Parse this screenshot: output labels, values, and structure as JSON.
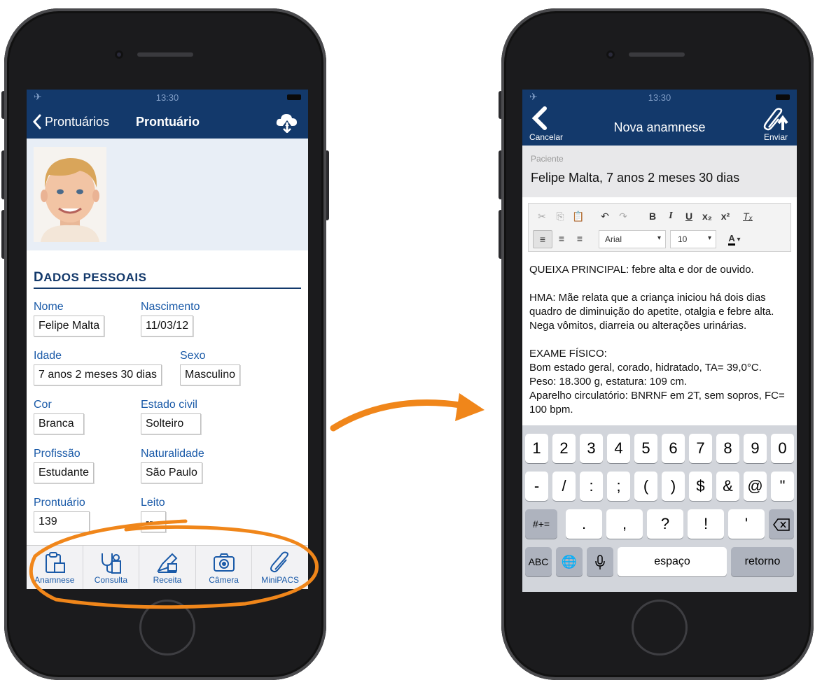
{
  "colors": {
    "nav": "#13396b",
    "accent": "#1a5aa8",
    "highlight": "#f0861a"
  },
  "left": {
    "status_time": "13:30",
    "nav": {
      "back_label": "Prontuários",
      "title": "Prontuário",
      "action_icon": "cloud-sync-icon"
    },
    "section_title_first": "D",
    "section_title_rest": "ADOS PESSOAIS",
    "fields": {
      "nome_label": "Nome",
      "nome_value": "Felipe Malta",
      "nascimento_label": "Nascimento",
      "nascimento_value": "11/03/12",
      "idade_label": "Idade",
      "idade_value": "7 anos 2 meses 30 dias",
      "sexo_label": "Sexo",
      "sexo_value": "Masculino",
      "cor_label": "Cor",
      "cor_value": "Branca",
      "estado_civil_label": "Estado civil",
      "estado_civil_value": "Solteiro",
      "profissao_label": "Profissão",
      "profissao_value": "Estudante",
      "naturalidade_label": "Naturalidade",
      "naturalidade_value": "São Paulo",
      "prontuario_label": "Prontuário",
      "prontuario_value": "139",
      "leito_label": "Leito",
      "leito_value": "--"
    },
    "tabs": {
      "anamnese": "Anamnese",
      "consulta": "Consulta",
      "receita": "Receita",
      "camera": "Câmera",
      "minipacs": "MiniPACS"
    }
  },
  "right": {
    "status_time": "13:30",
    "nav": {
      "cancel_label": "Cancelar",
      "title": "Nova anamnese",
      "send_label": "Enviar"
    },
    "patient_label": "Paciente",
    "patient_value": "Felipe Malta, 7 anos 2 meses 30 dias",
    "toolbar": {
      "font": "Arial",
      "size": "10"
    },
    "editor": {
      "p1": "QUEIXA PRINCIPAL: febre alta e dor de ouvido.",
      "p2": "HMA: Mãe relata que a criança iniciou há dois dias quadro de diminuição do apetite, otalgia e febre alta. Nega vômitos, diarreia ou alterações urinárias.",
      "p3_title": "EXAME FÍSICO:",
      "p3_l1": "Bom estado geral, corado, hidratado, TA= 39,0°C.",
      "p3_l2": "Peso: 18.300 g, estatura: 109 cm.",
      "p3_l3": "Aparelho circulatório: BNRNF em 2T, sem sopros, FC= 100 bpm."
    },
    "keyboard": {
      "row1": [
        "1",
        "2",
        "3",
        "4",
        "5",
        "6",
        "7",
        "8",
        "9",
        "0"
      ],
      "row2": [
        "-",
        "/",
        ":",
        ";",
        "(",
        ")",
        "$",
        "&",
        "@",
        "\""
      ],
      "row3": [
        "#+=",
        ".",
        ",",
        "?",
        "!",
        "'"
      ],
      "abc": "ABC",
      "space": "espaço",
      "return": "retorno"
    }
  }
}
